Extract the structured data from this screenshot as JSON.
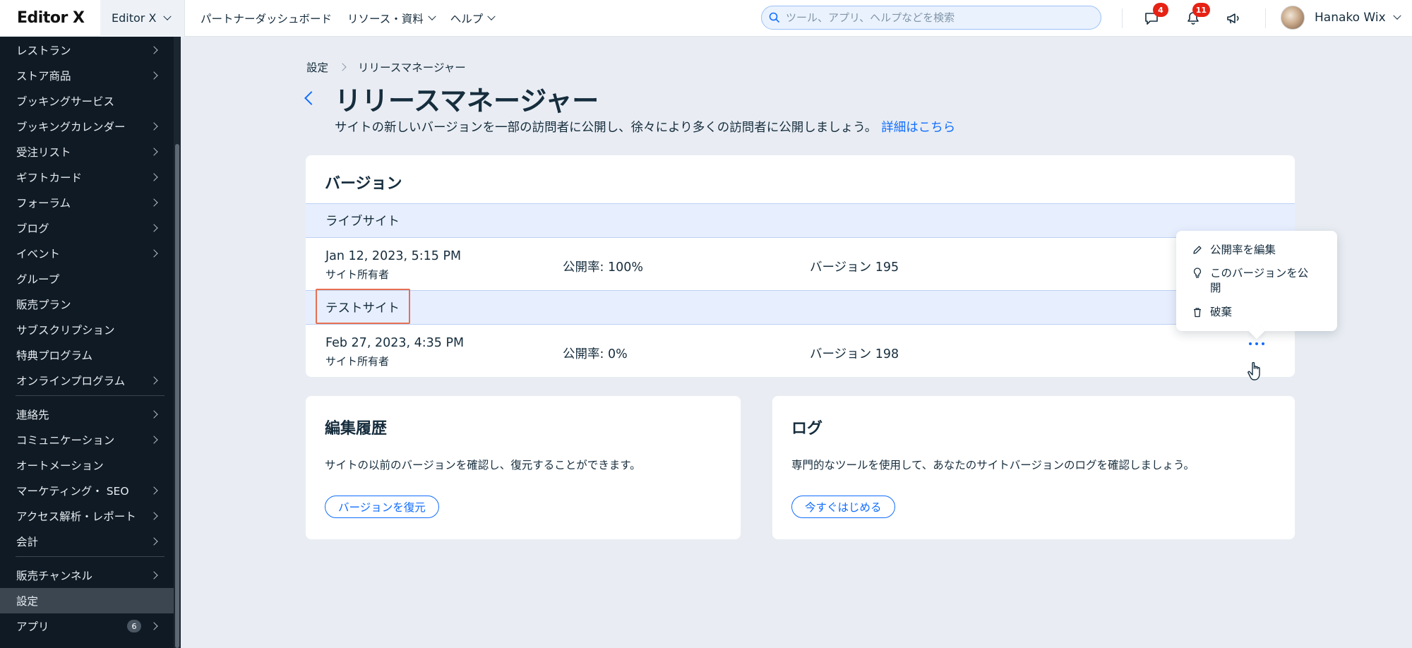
{
  "topbar": {
    "logo": "Editor X",
    "site_selector": "Editor X",
    "nav": [
      {
        "label": "パートナーダッシュボード",
        "has_menu": false
      },
      {
        "label": "リソース・資料",
        "has_menu": true
      },
      {
        "label": "ヘルプ",
        "has_menu": true
      }
    ],
    "search_placeholder": "ツール、アプリ、ヘルプなどを検索",
    "messages_count": "4",
    "notifications_count": "11",
    "user_name": "Hanako Wix"
  },
  "sidebar": {
    "items": [
      {
        "label": "レストラン",
        "chevron": true
      },
      {
        "label": "ストア商品",
        "chevron": true
      },
      {
        "label": "ブッキングサービス",
        "chevron": false
      },
      {
        "label": "ブッキングカレンダー",
        "chevron": true
      },
      {
        "label": "受注リスト",
        "chevron": true
      },
      {
        "label": "ギフトカード",
        "chevron": true
      },
      {
        "label": "フォーラム",
        "chevron": true
      },
      {
        "label": "ブログ",
        "chevron": true
      },
      {
        "label": "イベント",
        "chevron": true
      },
      {
        "label": "グループ",
        "chevron": false
      },
      {
        "label": "販売プラン",
        "chevron": false
      },
      {
        "label": "サブスクリプション",
        "chevron": false
      },
      {
        "label": "特典プログラム",
        "chevron": false
      },
      {
        "label": "オンラインプログラム",
        "chevron": true
      }
    ],
    "items2": [
      {
        "label": "連絡先",
        "chevron": true
      },
      {
        "label": "コミュニケーション",
        "chevron": true
      },
      {
        "label": "オートメーション",
        "chevron": false
      },
      {
        "label": "マーケティング・ SEO",
        "chevron": true
      },
      {
        "label": "アクセス解析・レポート",
        "chevron": true
      },
      {
        "label": "会計",
        "chevron": true
      }
    ],
    "items3": [
      {
        "label": "販売チャンネル",
        "chevron": true
      },
      {
        "label": "設定",
        "chevron": false,
        "active": true
      },
      {
        "label": "アプリ",
        "chevron": true,
        "count": "6"
      }
    ]
  },
  "breadcrumb": {
    "parent": "設定",
    "current": "リリースマネージャー"
  },
  "page": {
    "title": "リリースマネージャー",
    "subtitle": "サイトの新しいバージョンを一部の訪問者に公開し、徐々により多くの訪問者に公開しましょう。",
    "learn_more": "詳細はこちら"
  },
  "versions_card": {
    "title": "バージョン",
    "live_group": "ライブサイト",
    "live_row": {
      "date": "Jan 12, 2023, 5:15 PM",
      "owner": "サイト所有者",
      "rate": "公開率: 100%",
      "version": "バージョン 195"
    },
    "test_group": "テストサイト",
    "test_row": {
      "date": "Feb 27, 2023, 4:35 PM",
      "owner": "サイト所有者",
      "rate": "公開率: 0%",
      "version": "バージョン 198"
    }
  },
  "popover": {
    "edit_rate": "公開率を編集",
    "publish_version": "このバージョンを公開",
    "discard": "破棄"
  },
  "history_card": {
    "title": "編集履歴",
    "description": "サイトの以前のバージョンを確認し、復元することができます。",
    "button": "バージョンを復元"
  },
  "log_card": {
    "title": "ログ",
    "description": "専門的なツールを使用して、あなたのサイトバージョンのログを確認しましょう。",
    "button": "今すぐはじめる"
  },
  "colors": {
    "accent": "#116dff",
    "sidebar_bg": "#0f1a24",
    "highlight_border": "#e76f51",
    "badge": "#e62214"
  }
}
